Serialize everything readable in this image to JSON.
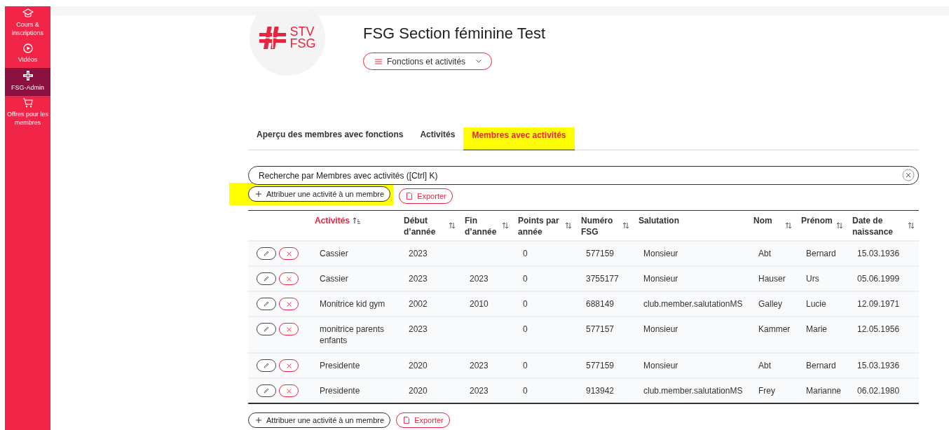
{
  "sidebar": {
    "items": [
      {
        "label": "Cours & inscriptions",
        "selected": false
      },
      {
        "label": "Vidéos",
        "selected": false
      },
      {
        "label": "FSG-Admin",
        "selected": true
      },
      {
        "label": "Offres pour les membres",
        "selected": false
      }
    ]
  },
  "header": {
    "logo_text": [
      "STV",
      "FSG"
    ],
    "title": "FSG Section féminine Test",
    "menu_button": "Fonctions et activités"
  },
  "tabs": [
    {
      "label": "Aperçu des membres avec fonctions",
      "selected": false,
      "highlighted": false
    },
    {
      "label": "Activités",
      "selected": false,
      "highlighted": false
    },
    {
      "label": "Membres avec activités",
      "selected": true,
      "highlighted": true
    }
  ],
  "search": {
    "placeholder": "Recherche par Membres avec activités ([Ctrl] K)"
  },
  "toolbar": [
    {
      "kind": "add",
      "label": "Attribuer une activité à un membre",
      "highlighted": true
    },
    {
      "kind": "export",
      "label": "Exporter",
      "highlighted": false
    }
  ],
  "table": {
    "columns": [
      {
        "label": "Activités",
        "sortable": true,
        "sorted": true
      },
      {
        "label": "Début d’année",
        "sortable": true,
        "sorted": false
      },
      {
        "label": "Fin d’année",
        "sortable": true,
        "sorted": false
      },
      {
        "label": "Points par année",
        "sortable": true,
        "sorted": false
      },
      {
        "label": "Numéro FSG",
        "sortable": true,
        "sorted": false
      },
      {
        "label": "Salutation",
        "sortable": false,
        "sorted": false
      },
      {
        "label": "Nom",
        "sortable": true,
        "sorted": false
      },
      {
        "label": "Prénom",
        "sortable": true,
        "sorted": false
      },
      {
        "label": "Date de naissance",
        "sortable": true,
        "sorted": false
      }
    ],
    "rows": [
      [
        "Cassier",
        "2023",
        "",
        "0",
        "577159",
        "Monsieur",
        "Abt",
        "Bernard",
        "15.03.1936"
      ],
      [
        "Cassier",
        "2023",
        "2023",
        "0",
        "3755177",
        "Monsieur",
        "Hauser",
        "Urs",
        "05.06.1999"
      ],
      [
        "Monitrice kid gym",
        "2002",
        "2010",
        "0",
        "688149",
        "club.member.salutationMS",
        "Galley",
        "Lucie",
        "12.09.1971"
      ],
      [
        "monitrice parents enfants",
        "2023",
        "",
        "0",
        "577157",
        "Monsieur",
        "Kammer",
        "Marie",
        "12.05.1956"
      ],
      [
        "Presidente",
        "2020",
        "2023",
        "0",
        "577159",
        "Monsieur",
        "Abt",
        "Bernard",
        "15.03.1936"
      ],
      [
        "Presidente",
        "2020",
        "2023",
        "0",
        "913942",
        "club.member.salutationMS",
        "Frey",
        "Marianne",
        "06.02.1980"
      ]
    ]
  },
  "bottom_toolbar": [
    {
      "kind": "add",
      "label": "Attribuer une activité à un membre",
      "highlighted": false
    },
    {
      "kind": "export",
      "label": "Exporter",
      "highlighted": false
    }
  ]
}
